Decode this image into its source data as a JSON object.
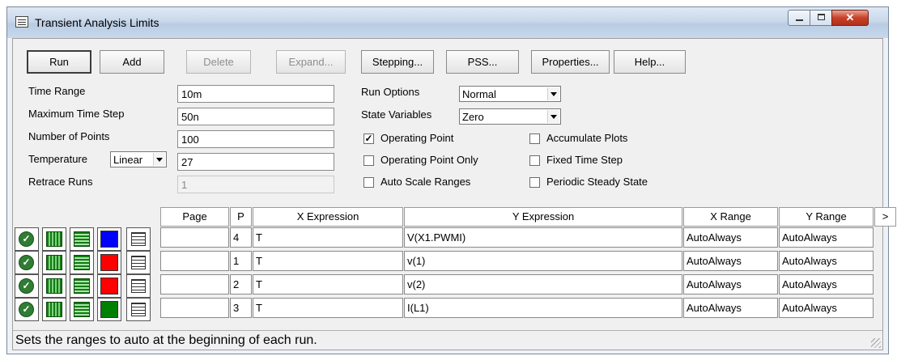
{
  "window": {
    "title": "Transient Analysis Limits"
  },
  "toolbar": {
    "run": "Run",
    "add": "Add",
    "delete": "Delete",
    "expand": "Expand...",
    "stepping": "Stepping...",
    "pss": "PSS...",
    "properties": "Properties...",
    "help": "Help..."
  },
  "fields": {
    "time_range": {
      "label": "Time Range",
      "value": "10m"
    },
    "max_time_step": {
      "label": "Maximum Time Step",
      "value": "50n"
    },
    "num_points": {
      "label": "Number of Points",
      "value": "100"
    },
    "temperature": {
      "label": "Temperature",
      "mode": "Linear",
      "value": "27"
    },
    "retrace_runs": {
      "label": "Retrace Runs",
      "value": "1"
    }
  },
  "run_options": {
    "label": "Run Options",
    "value": "Normal"
  },
  "state_variables": {
    "label": "State Variables",
    "value": "Zero"
  },
  "checkboxes": {
    "operating_point": {
      "label": "Operating Point",
      "checked": true
    },
    "operating_point_only": {
      "label": "Operating Point Only",
      "checked": false
    },
    "auto_scale_ranges": {
      "label": "Auto Scale Ranges",
      "checked": false
    },
    "accumulate_plots": {
      "label": "Accumulate Plots",
      "checked": false
    },
    "fixed_time_step": {
      "label": "Fixed Time Step",
      "checked": false
    },
    "periodic_steady_state": {
      "label": "Periodic Steady State",
      "checked": false
    }
  },
  "table": {
    "headers": {
      "page": "Page",
      "p": "P",
      "x_expr": "X Expression",
      "y_expr": "Y Expression",
      "x_range": "X Range",
      "y_range": "Y Range",
      "more": ">"
    },
    "rows": [
      {
        "page": "",
        "p": "4",
        "x": "T",
        "y": "V(X1.PWMI)",
        "x_range": "AutoAlways",
        "y_range": "AutoAlways",
        "color": "#0000ff"
      },
      {
        "page": "",
        "p": "1",
        "x": "T",
        "y": "v(1)",
        "x_range": "AutoAlways",
        "y_range": "AutoAlways",
        "color": "#ff0000"
      },
      {
        "page": "",
        "p": "2",
        "x": "T",
        "y": "v(2)",
        "x_range": "AutoAlways",
        "y_range": "AutoAlways",
        "color": "#ff0000"
      },
      {
        "page": "",
        "p": "3",
        "x": "T",
        "y": "I(L1)",
        "x_range": "AutoAlways",
        "y_range": "AutoAlways",
        "color": "#008000"
      }
    ]
  },
  "status": "Sets the ranges to auto at the beginning of each run."
}
